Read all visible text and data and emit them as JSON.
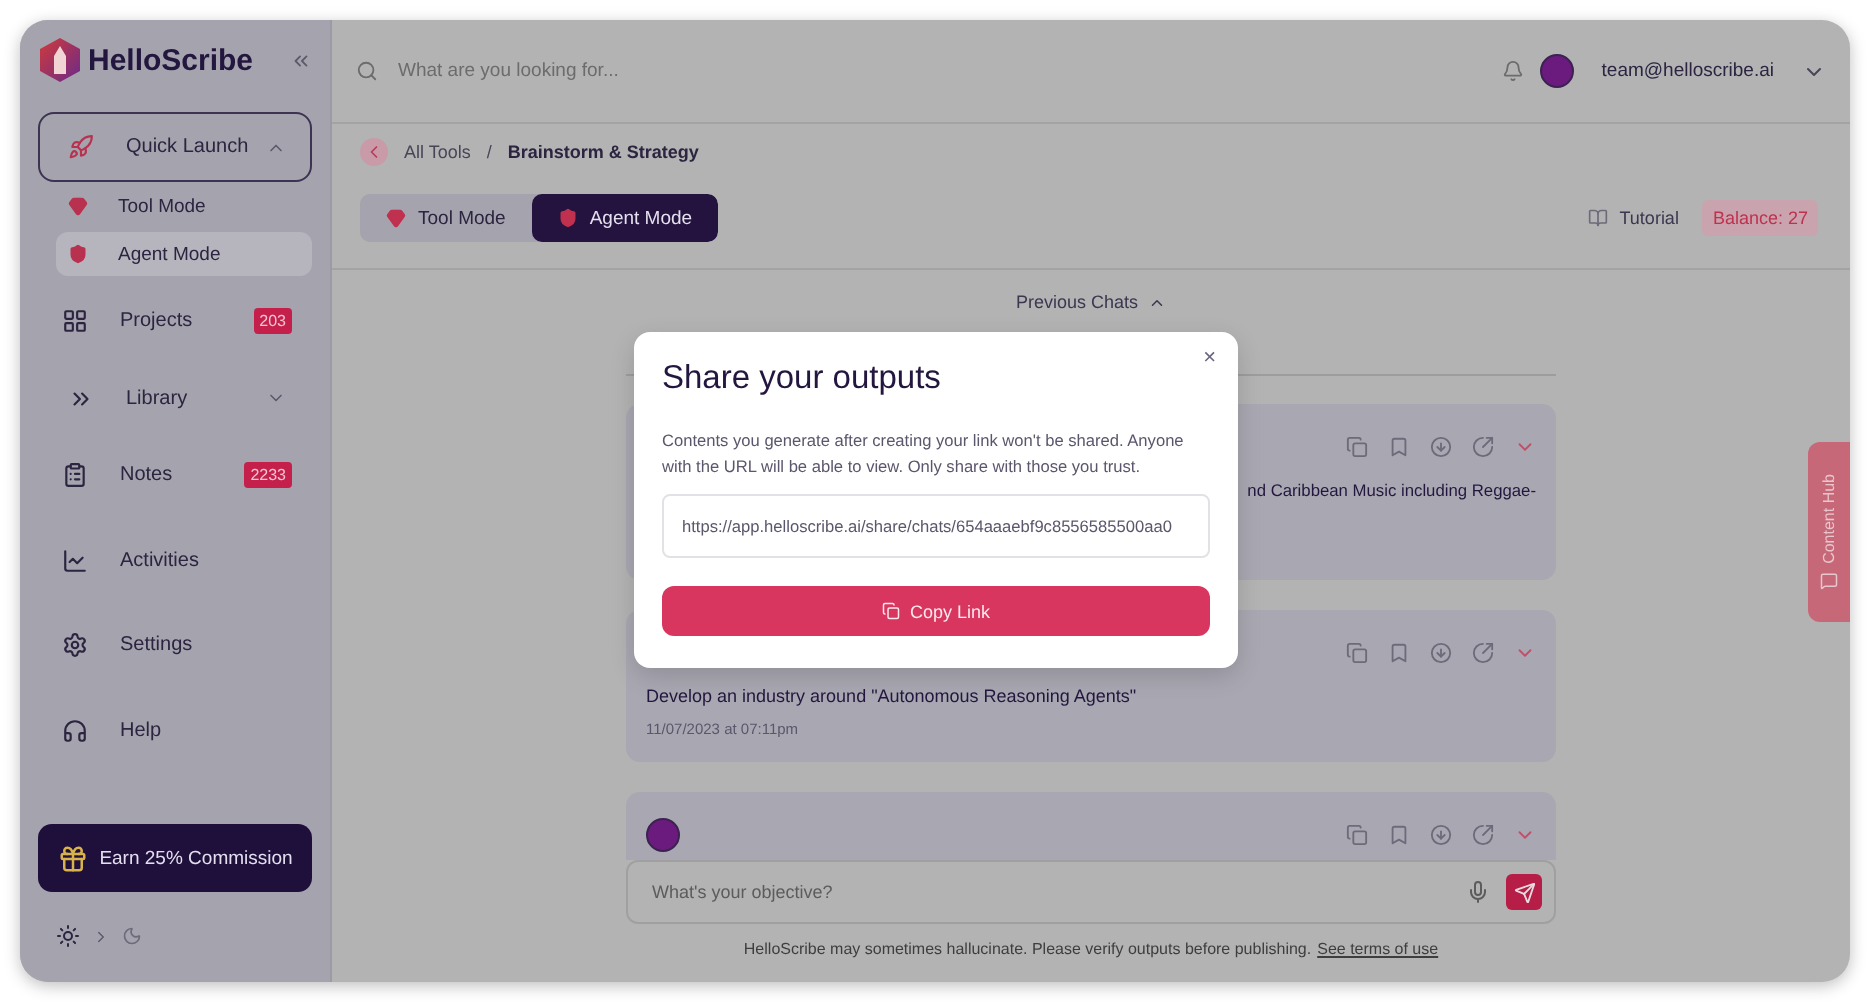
{
  "brand": {
    "name": "HelloScribe"
  },
  "sidebar": {
    "items": [
      {
        "kind": "group",
        "label": "Quick Launch",
        "expanded": true,
        "children": [
          {
            "label": "Tool Mode",
            "selected": false
          },
          {
            "label": "Agent Mode",
            "selected": true
          }
        ]
      },
      {
        "kind": "link",
        "label": "Projects",
        "badge": "203"
      },
      {
        "kind": "group",
        "label": "Library",
        "expanded": false
      },
      {
        "kind": "link",
        "label": "Notes",
        "badge": "2233"
      },
      {
        "kind": "link",
        "label": "Activities"
      },
      {
        "kind": "link",
        "label": "Settings"
      },
      {
        "kind": "link",
        "label": "Help"
      }
    ]
  },
  "promo": {
    "label": "Earn 25% Commission"
  },
  "theme": {
    "dark": false
  },
  "topbar": {
    "search_placeholder": "What are you looking for...",
    "user_email": "team@helloscribe.ai"
  },
  "breadcrumb": {
    "items": [
      "All Tools",
      "Brainstorm & Strategy"
    ],
    "separator": "/"
  },
  "modes": [
    {
      "label": "Tool Mode",
      "selected": false
    },
    {
      "label": "Agent Mode",
      "selected": true
    }
  ],
  "tutorial": "Tutorial",
  "balance": "Balance: 27",
  "previous_chats": {
    "label": "Previous Chats",
    "expanded": true
  },
  "chats": [
    {
      "text": "nd Caribbean Music including Reggae-"
    },
    {
      "text": "Develop an industry around \"Autonomous Reasoning Agents\"",
      "date": "11/07/2023 at 07:11pm"
    }
  ],
  "composer": {
    "placeholder": "What's your objective?"
  },
  "footer": {
    "text": "HelloScribe may sometimes hallucinate. Please verify outputs before publishing.",
    "link": "See terms of use"
  },
  "content_hub": "Content Hub",
  "modal": {
    "title": "Share your outputs",
    "close": "×",
    "body": "Contents you generate after creating your link won't be shared. Anyone with the URL will be able to view. Only share with those you trust.",
    "url": "https://app.helloscribe.ai/share/chats/654aaaebf9c8556585500aa0",
    "button": "Copy Link"
  }
}
